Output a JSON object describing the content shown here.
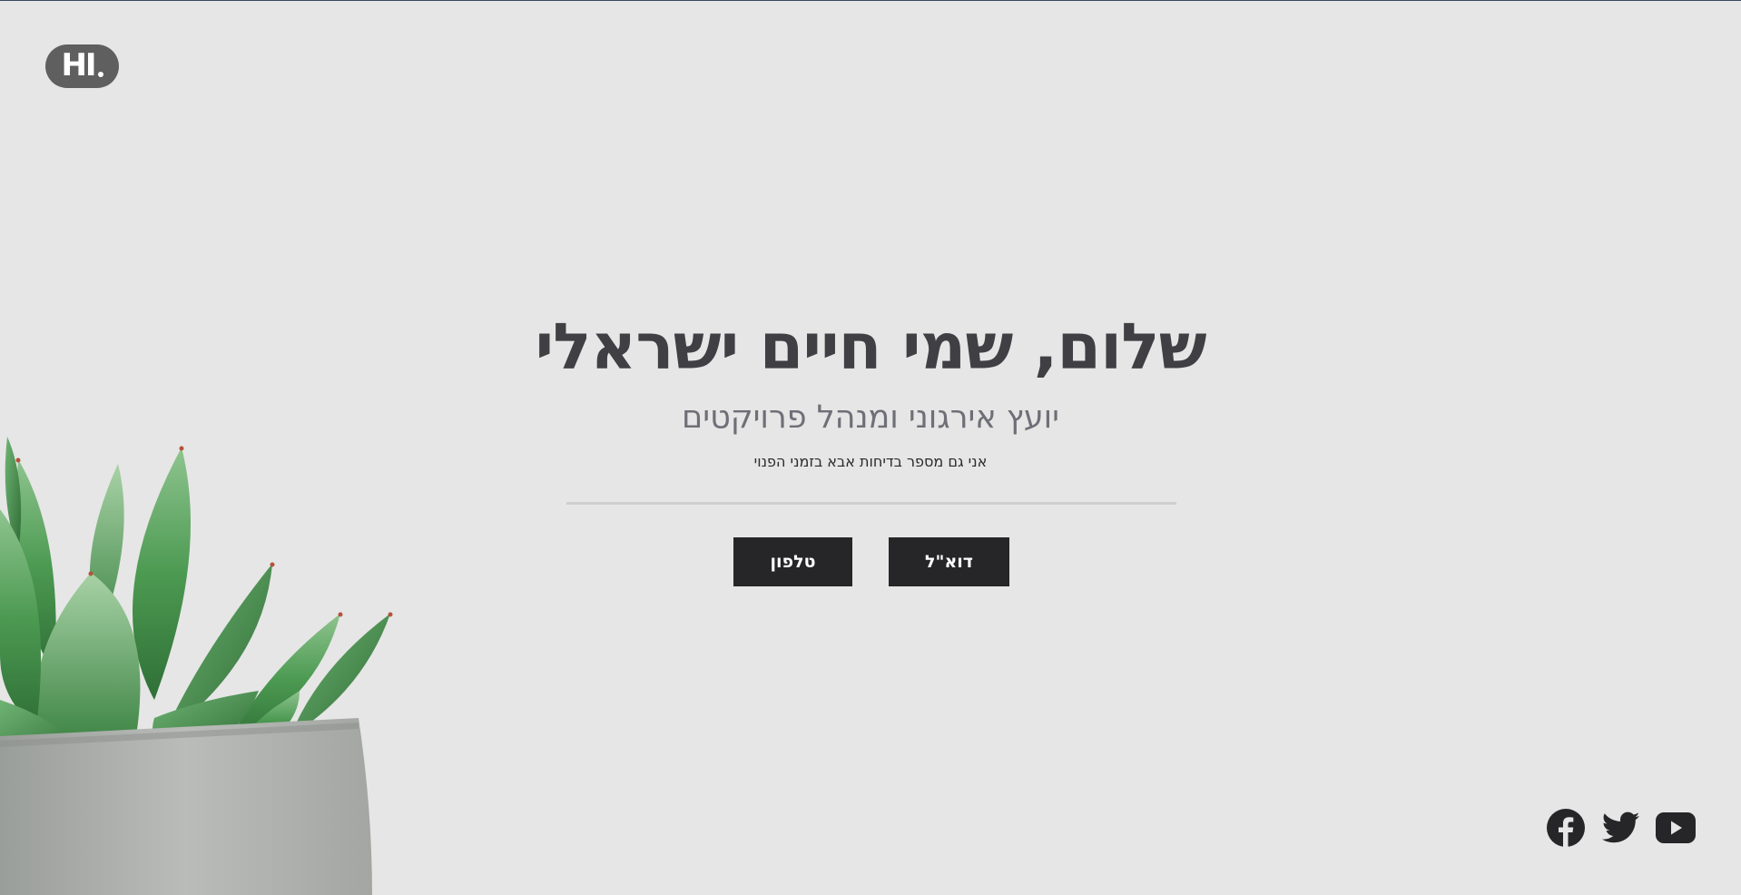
{
  "logo": {
    "text": "HI"
  },
  "hero": {
    "title": "שלום, שמי חיים ישראלי",
    "subtitle": "יועץ אירגוני ומנהל פרויקטים",
    "description": "אני גם מספר בדיחות אבא בזמני הפנוי"
  },
  "buttons": {
    "email_label": "דוא\"ל",
    "phone_label": "טלפון"
  },
  "social": {
    "icons": [
      "facebook-icon",
      "twitter-icon",
      "youtube-icon"
    ]
  },
  "colors": {
    "background": "#e6e6e6",
    "button_bg": "#262628",
    "title": "#3f3f44",
    "subtitle": "#6f6f78",
    "logo_bg": "#5f5f5f"
  }
}
